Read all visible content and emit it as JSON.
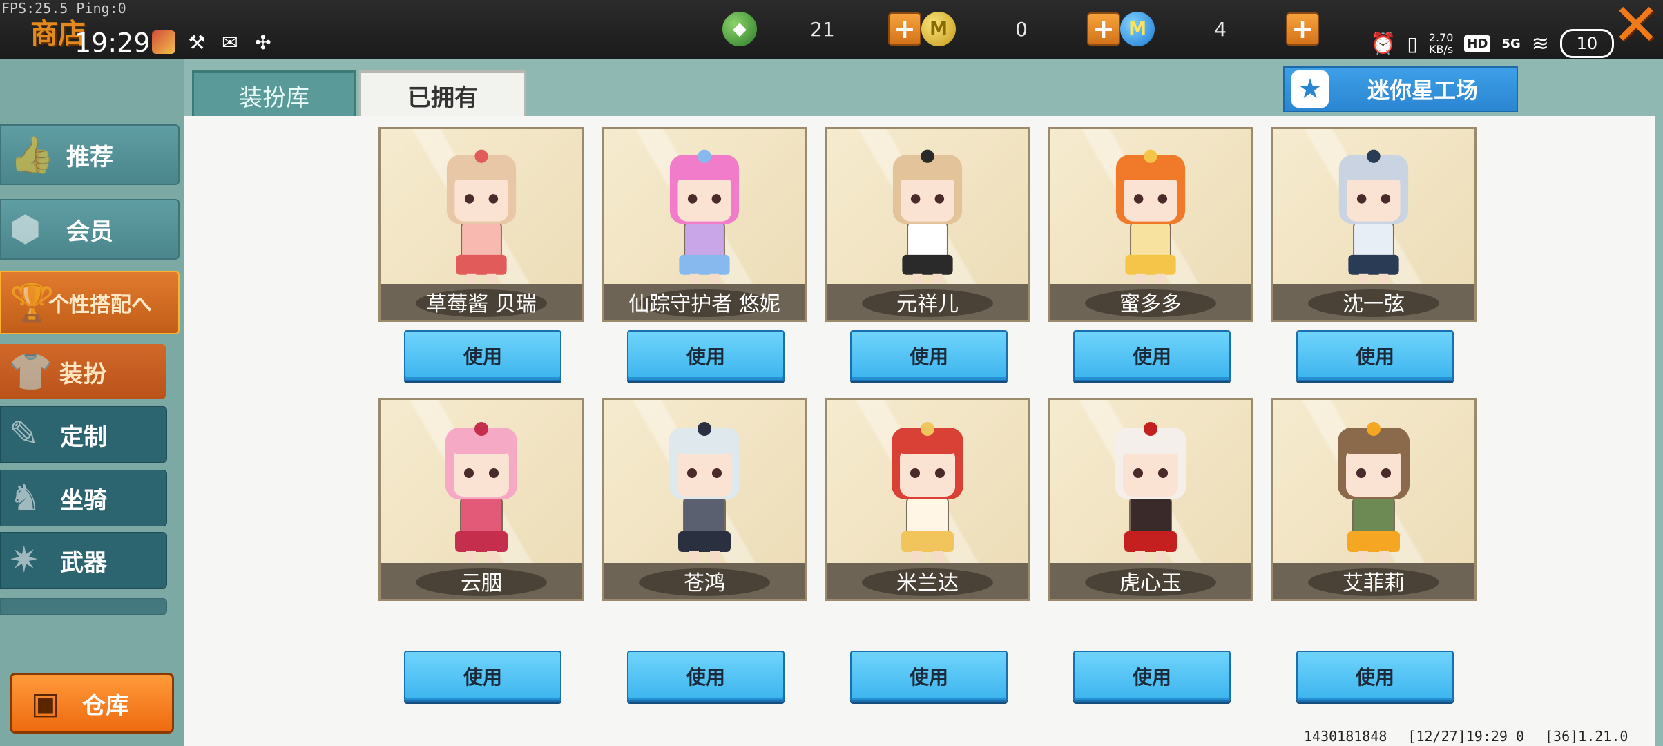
{
  "overlay": {
    "fps": "FPS:25.5  Ping:0"
  },
  "header": {
    "title": "商店",
    "time": "19:29"
  },
  "currencies": [
    {
      "icon": "green-gem-icon",
      "value": "21",
      "color": "#3e9a36"
    },
    {
      "icon": "gold-coin-icon",
      "value": "0",
      "color": "#d9b32c"
    },
    {
      "icon": "blue-coin-icon",
      "value": "4",
      "color": "#2b86d2"
    }
  ],
  "system": {
    "speed": "2.70",
    "speed_unit": "KB/s",
    "hd": "HD",
    "network": "5G",
    "battery": "10"
  },
  "sidebar": {
    "items": [
      {
        "label": "推荐"
      },
      {
        "label": "会员"
      },
      {
        "label": "个性搭配へ"
      },
      {
        "label": "装扮"
      },
      {
        "label": "定制"
      },
      {
        "label": "坐骑"
      },
      {
        "label": "武器"
      }
    ],
    "warehouse": "仓库"
  },
  "tabs": {
    "dress_library": "装扮库",
    "owned": "已拥有"
  },
  "workshop": {
    "label": "迷你星工场"
  },
  "use_label": "使用",
  "outfits": [
    {
      "name": "草莓酱 贝瑞",
      "hair": "#e8c7a6",
      "accent": "#e25b5b",
      "body": "#f7b9b0"
    },
    {
      "name": "仙踪守护者 悠妮",
      "hair": "#f17cc9",
      "accent": "#88b9ee",
      "body": "#c9a6e8"
    },
    {
      "name": "元祥儿",
      "hair": "#e3c39a",
      "accent": "#2a2a2a",
      "body": "#ffffff"
    },
    {
      "name": "蜜多多",
      "hair": "#f07a2a",
      "accent": "#f5c54a",
      "body": "#f8e2a0"
    },
    {
      "name": "沈一弦",
      "hair": "#c9d3e2",
      "accent": "#2a3b55",
      "body": "#e8eef6"
    },
    {
      "name": "云胭",
      "hair": "#f6a9c4",
      "accent": "#c62e4e",
      "body": "#e35a78"
    },
    {
      "name": "苍鸿",
      "hair": "#dfe8ec",
      "accent": "#2a3040",
      "body": "#5a6070"
    },
    {
      "name": "米兰达",
      "hair": "#d94136",
      "accent": "#f1c45c",
      "body": "#fff6e6"
    },
    {
      "name": "虎心玉",
      "hair": "#f4efea",
      "accent": "#c42020",
      "body": "#3a2a2a"
    },
    {
      "name": "艾菲莉",
      "hair": "#8a6a4a",
      "accent": "#f5a623",
      "body": "#6d8a55"
    }
  ],
  "footer": {
    "uid": "1430181848",
    "datetime": "[12/27]19:29 0",
    "version": "[36]1.21.0"
  }
}
